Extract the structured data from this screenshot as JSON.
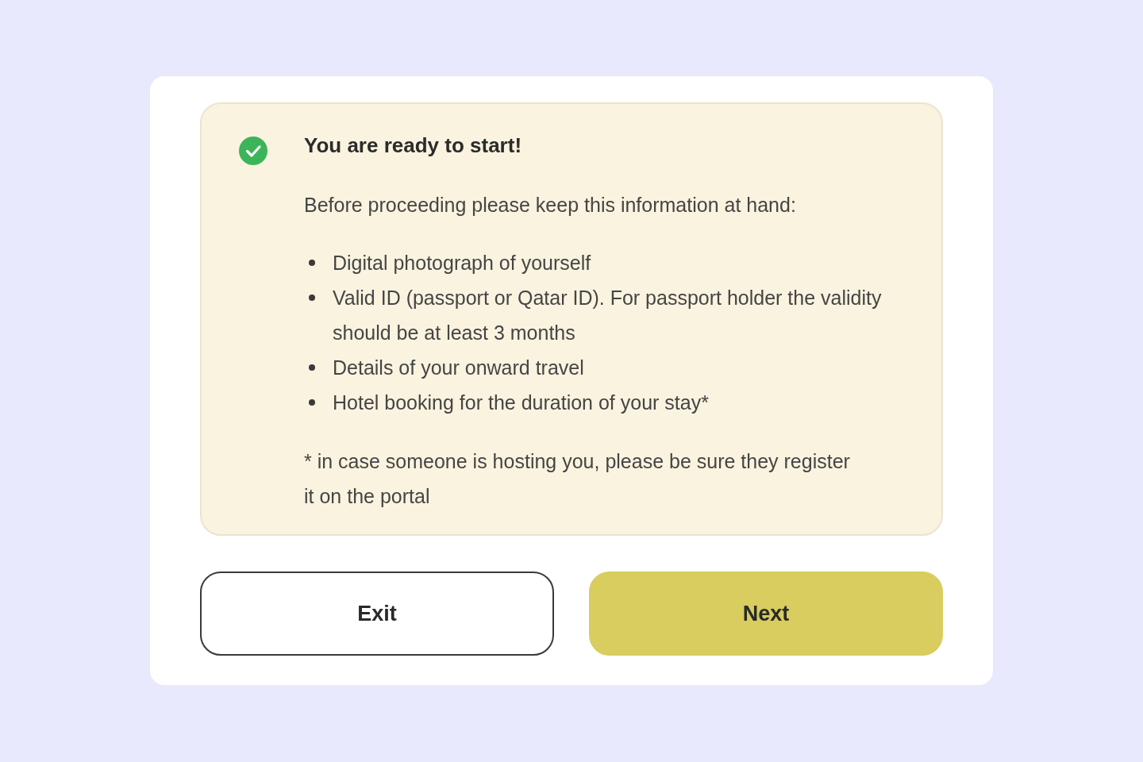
{
  "notice": {
    "title": "You are ready to start!",
    "intro": "Before proceeding please keep this information at hand:",
    "items": [
      "Digital photograph of yourself",
      "Valid ID (passport or Qatar ID). For passport holder the validity should be at least 3 months",
      "Details of your onward travel",
      "Hotel booking for the duration of your stay*"
    ],
    "footnote": "* in case someone is hosting you, please be sure they register it on the portal"
  },
  "buttons": [
    {
      "label": "Exit",
      "kind": "secondary"
    },
    {
      "label": "Next",
      "kind": "primary"
    }
  ]
}
